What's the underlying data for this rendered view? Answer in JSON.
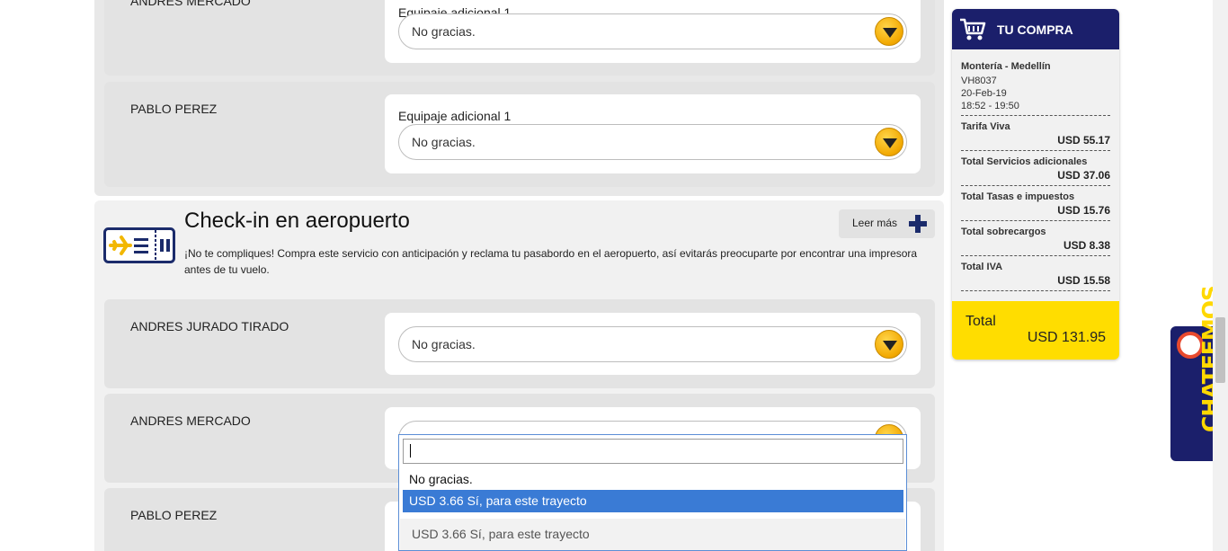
{
  "top_section": {
    "rows": [
      {
        "name": "ANDRES MERCADO",
        "option_label": "Equipaje adicional 1",
        "selected": "No gracias."
      },
      {
        "name": "PABLO PEREZ",
        "option_label": "Equipaje adicional 1",
        "selected": "No gracias."
      }
    ]
  },
  "checkin": {
    "title": "Check-in en aeropuerto",
    "description": "¡No te compliques! Compra este servicio con anticipación y reclama tu pasabordo en el aeropuerto, así evitarás preocuparte por encontrar una impresora antes de tu vuelo.",
    "read_more": "Leer más",
    "rows": [
      {
        "name": "ANDRES JURADO TIRADO",
        "selected": "No gracias."
      },
      {
        "name": "ANDRES MERCADO",
        "selected": ""
      },
      {
        "name": "PABLO PEREZ",
        "selected": ""
      }
    ]
  },
  "dropdown": {
    "search_value": "",
    "options": [
      "No gracias.",
      "USD 3.66 Sí, para este trayecto"
    ],
    "highlighted_index": 1,
    "below_text": "USD 3.66 Sí, para este trayecto"
  },
  "summary": {
    "title": "TU COMPRA",
    "route": "Montería - Medellín",
    "flight": "VH8037",
    "date": "20-Feb-19",
    "time": "18:52 - 19:50",
    "lines": [
      {
        "label": "Tarifa Viva",
        "amount": "USD 55.17"
      },
      {
        "label": "Total Servicios adicionales",
        "amount": "USD 37.06"
      },
      {
        "label": "Total Tasas e impuestos",
        "amount": "USD 15.76"
      },
      {
        "label": "Total sobrecargos",
        "amount": "USD 8.38"
      },
      {
        "label": "Total IVA",
        "amount": "USD 15.58"
      }
    ],
    "total_label": "Total",
    "total_amount": "USD 131.95"
  },
  "chat": {
    "label": "CHATEEMOS"
  },
  "colors": {
    "navy": "#1b1f6b",
    "yellow": "#ffdd00",
    "highlight": "#3a7bd5"
  }
}
